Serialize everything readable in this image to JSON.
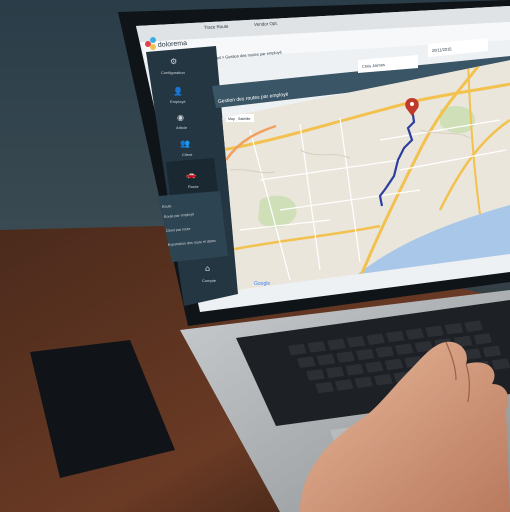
{
  "app": {
    "logo_text": "dolorema",
    "tabs": [
      "Trace Route",
      "Vendor Opt."
    ],
    "breadcrumb": "Accueil > Gestion des routes par employé",
    "panel_title": "Gestion des routes par employé",
    "employee_select": "Chris Jaimes",
    "date_field": "20/11/2015"
  },
  "sidebar": {
    "items": [
      {
        "label": "Configuration",
        "icon": "gear-icon"
      },
      {
        "label": "Employé",
        "icon": "user-icon"
      },
      {
        "label": "Article",
        "icon": "globe-icon"
      },
      {
        "label": "Client",
        "icon": "people-icon"
      },
      {
        "label": "Route",
        "icon": "car-icon"
      },
      {
        "label": "Compte",
        "icon": "home-icon"
      }
    ],
    "submenu": [
      "Route",
      "Route par employé",
      "Client par route",
      "Exportation des route et dates"
    ]
  },
  "map": {
    "map_btn": "Map",
    "satellite_btn": "Satellite",
    "attribution": "Google"
  },
  "colors": {
    "sidebar": "#243642",
    "panel_header": "#3a5566",
    "route": "#2b3fa0",
    "water": "#a9c7e8",
    "road": "#f2c14e"
  }
}
